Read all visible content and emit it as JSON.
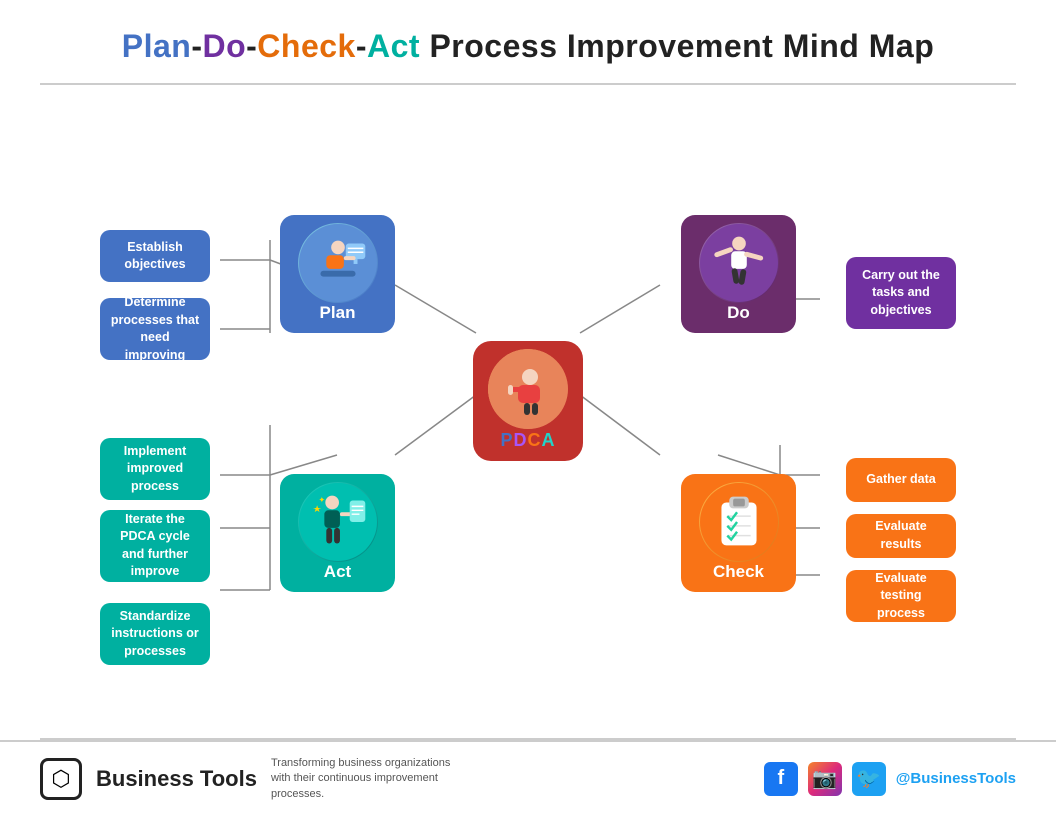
{
  "title": {
    "plan": "Plan",
    "dash1": "-",
    "do": "Do",
    "dash2": "-",
    "check": "Check",
    "dash3": "-",
    "act": "Act",
    "rest": " Process Improvement Mind Map"
  },
  "pdca": {
    "label": "PDCA"
  },
  "nodes": {
    "plan": {
      "label": "Plan"
    },
    "do": {
      "label": "Do"
    },
    "act": {
      "label": "Act"
    },
    "check": {
      "label": "Check"
    }
  },
  "leaves": {
    "establish": "Establish objectives",
    "determine": "Determine processes that need improving",
    "implement": "Implement improved process",
    "iterate": "Iterate the PDCA cycle and further improve",
    "standardize": "Standardize instructions or processes",
    "carry": "Carry out the tasks and objectives",
    "gather": "Gather data",
    "evaluate_results": "Evaluate results",
    "evaluate_testing": "Evaluate testing process"
  },
  "footer": {
    "brand": "Business Tools",
    "tagline": "Transforming business organizations with their continuous improvement processes.",
    "handle": "@BusinessTools"
  }
}
